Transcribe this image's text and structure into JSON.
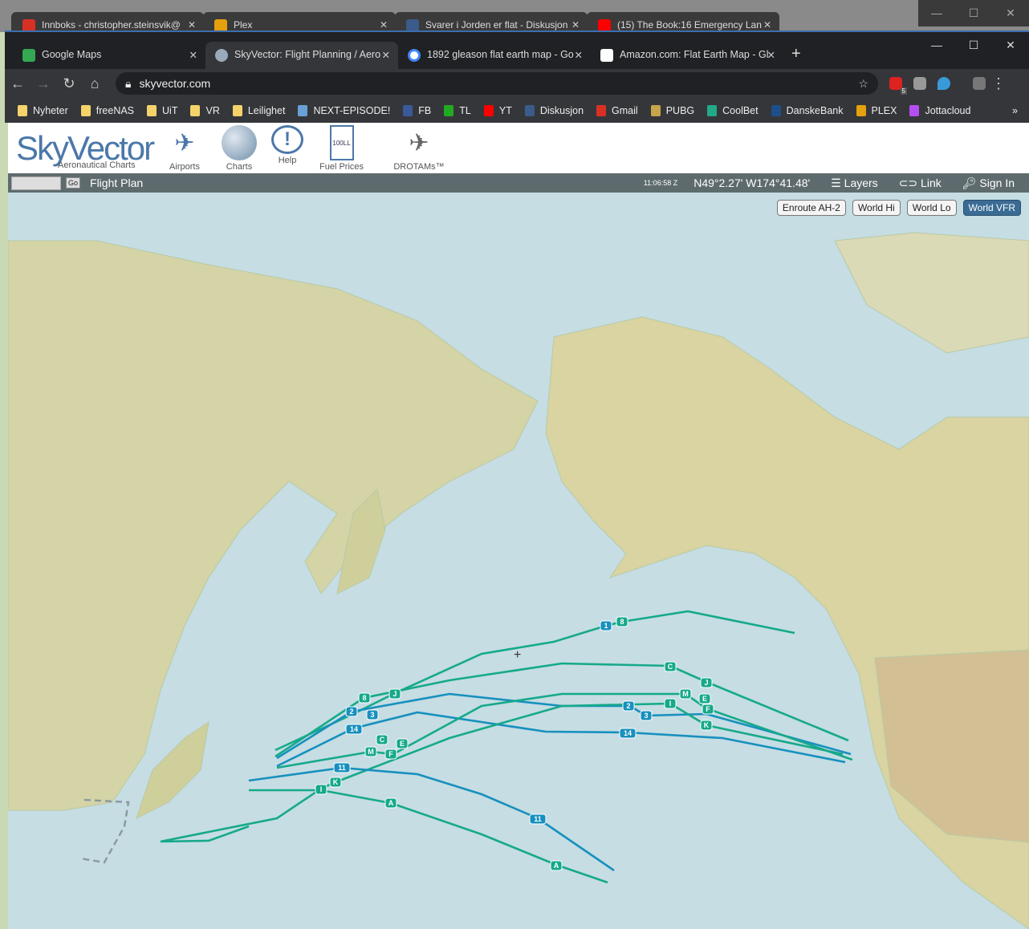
{
  "background_window": {
    "tabs": [
      {
        "label": "Innboks - christopher.steinsvik@",
        "icon": "gmail-icon",
        "color": "#d93025"
      },
      {
        "label": "Plex",
        "icon": "plex-icon",
        "color": "#e5a00d"
      },
      {
        "label": "Svarer i Jorden er flat - Diskusjon",
        "icon": "diskusjon-icon",
        "color": "#3b5b8a"
      },
      {
        "label": "(15) The Book:16 Emergency Lan",
        "icon": "youtube-icon",
        "color": "#ff0000"
      }
    ]
  },
  "browser": {
    "tabs": [
      {
        "label": "Google Maps",
        "icon": "google-maps-icon",
        "color": "#34a853"
      },
      {
        "label": "SkyVector: Flight Planning / Aero",
        "icon": "skyvector-icon",
        "color": "#8aa"
      },
      {
        "label": "1892 gleason flat earth map - Go",
        "icon": "google-icon",
        "color": "#4285f4"
      },
      {
        "label": "Amazon.com: Flat Earth Map - Gl",
        "icon": "amazon-icon",
        "color": "#fff"
      }
    ],
    "url": "skyvector.com",
    "extension_badge": "5",
    "bookmarks": [
      {
        "label": "Nyheter",
        "color": "#f5d36b"
      },
      {
        "label": "freeNAS",
        "color": "#f5d36b"
      },
      {
        "label": "UiT",
        "color": "#f5d36b"
      },
      {
        "label": "VR",
        "color": "#f5d36b"
      },
      {
        "label": "Leilighet",
        "color": "#f5d36b"
      },
      {
        "label": "NEXT-EPISODE!",
        "color": "#6aa0d8"
      },
      {
        "label": "FB",
        "color": "#3b5998"
      },
      {
        "label": "TL",
        "color": "#2a2"
      },
      {
        "label": "YT",
        "color": "#f00"
      },
      {
        "label": "Diskusjon",
        "color": "#3b5b8a"
      },
      {
        "label": "Gmail",
        "color": "#d93025"
      },
      {
        "label": "PUBG",
        "color": "#c8a44c"
      },
      {
        "label": "CoolBet",
        "color": "#2a8"
      },
      {
        "label": "DanskeBank",
        "color": "#1d4f8a"
      },
      {
        "label": "PLEX",
        "color": "#e5a00d"
      },
      {
        "label": "Jottacloud",
        "color": "#b54ef0"
      }
    ],
    "more": "»"
  },
  "skyvector": {
    "logo": "SkyVector",
    "logo_sub": "Aeronautical Charts",
    "nav": [
      {
        "label": "Airports",
        "icon": "airports-icon"
      },
      {
        "label": "Charts",
        "icon": "globe-icon"
      },
      {
        "label": "Help",
        "icon": "help-icon"
      },
      {
        "label": "Fuel Prices",
        "icon": "fuel-sign-icon"
      },
      {
        "label": "DROTAMs™",
        "icon": "drone-icon"
      }
    ],
    "go": "Go",
    "flight_plan": "Flight Plan",
    "time": "11:06:58 Z",
    "coords": "N49°2.27' W174°41.48'",
    "layers": "Layers",
    "link": "Link",
    "sign_in": "Sign In",
    "chart_buttons": [
      "Enroute AH-2",
      "World Hi",
      "World Lo",
      "World VFR"
    ],
    "selected_chart": "World VFR"
  },
  "waypoints": {
    "r1": [
      "1",
      "8"
    ],
    "r2": [
      "C",
      "J"
    ],
    "r3": [
      "2",
      "3",
      "14",
      "J",
      "8"
    ],
    "r4": [
      "M",
      "E",
      "F",
      "I",
      "K",
      "C",
      "E",
      "M",
      "F",
      "11",
      "I",
      "K",
      "A",
      "11",
      "A",
      "2",
      "3",
      "14"
    ]
  },
  "colors": {
    "route_green": "#16a98a",
    "route_blue": "#1790be"
  }
}
